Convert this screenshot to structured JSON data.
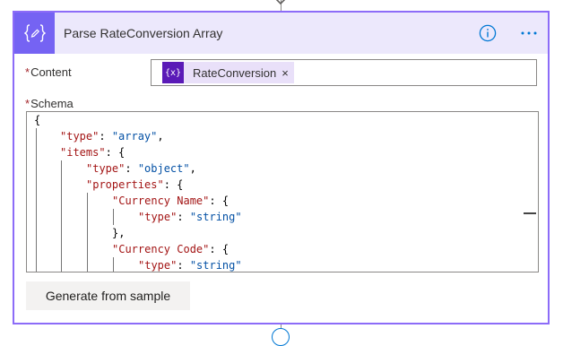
{
  "action": {
    "title": "Parse RateConversion Array",
    "header_icon": "braces-pen-icon",
    "info_icon": "info-icon",
    "more_icon": "ellipsis-icon"
  },
  "content_field": {
    "label": "Content",
    "required_mark": "*",
    "token": {
      "icon_text": "{x}",
      "label": "RateConversion",
      "remove": "×"
    }
  },
  "schema_field": {
    "label": "Schema",
    "required_mark": "*",
    "lines": [
      [
        {
          "t": "p",
          "v": "{"
        }
      ],
      [
        {
          "t": "k",
          "v": "\"type\""
        },
        {
          "t": "p",
          "v": ": "
        },
        {
          "t": "s",
          "v": "\"array\""
        },
        {
          "t": "p",
          "v": ","
        }
      ],
      [
        {
          "t": "k",
          "v": "\"items\""
        },
        {
          "t": "p",
          "v": ": {"
        }
      ],
      [
        {
          "t": "k",
          "v": "\"type\""
        },
        {
          "t": "p",
          "v": ": "
        },
        {
          "t": "s",
          "v": "\"object\""
        },
        {
          "t": "p",
          "v": ","
        }
      ],
      [
        {
          "t": "k",
          "v": "\"properties\""
        },
        {
          "t": "p",
          "v": ": {"
        }
      ],
      [
        {
          "t": "k",
          "v": "\"Currency Name\""
        },
        {
          "t": "p",
          "v": ": {"
        }
      ],
      [
        {
          "t": "k",
          "v": "\"type\""
        },
        {
          "t": "p",
          "v": ": "
        },
        {
          "t": "s",
          "v": "\"string\""
        }
      ],
      [
        {
          "t": "p",
          "v": "},"
        }
      ],
      [
        {
          "t": "k",
          "v": "\"Currency Code\""
        },
        {
          "t": "p",
          "v": ": {"
        }
      ],
      [
        {
          "t": "k",
          "v": "\"type\""
        },
        {
          "t": "p",
          "v": ": "
        },
        {
          "t": "s",
          "v": "\"string\""
        }
      ]
    ]
  },
  "generate_button": {
    "label": "Generate from sample"
  },
  "colors": {
    "header_bg": "#ece8fc",
    "header_icon_bg": "#7563f3",
    "card_border": "#8c6cf8",
    "token_bg": "#e9e0f9",
    "token_icon_bg": "#5a1ab7",
    "json_key": "#a31515",
    "json_string": "#0451a5",
    "info_blue": "#0078d4"
  }
}
